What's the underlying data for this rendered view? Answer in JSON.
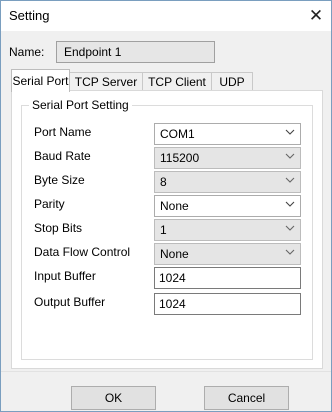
{
  "window": {
    "title": "Setting",
    "close_glyph": "✕"
  },
  "name_field": {
    "label": "Name:",
    "value": "Endpoint 1"
  },
  "tabs": [
    {
      "label": "Serial Port",
      "active": true
    },
    {
      "label": "TCP Server",
      "active": false
    },
    {
      "label": "TCP Client",
      "active": false
    },
    {
      "label": "UDP",
      "active": false
    }
  ],
  "serial": {
    "group_title": "Serial Port Setting",
    "port_name": {
      "label": "Port Name",
      "value": "COM1"
    },
    "baud_rate": {
      "label": "Baud Rate",
      "value": "115200"
    },
    "byte_size": {
      "label": "Byte Size",
      "value": "8"
    },
    "parity": {
      "label": "Parity",
      "value": "None"
    },
    "stop_bits": {
      "label": "Stop Bits",
      "value": "1"
    },
    "flow_control": {
      "label": "Data Flow Control",
      "value": "None"
    },
    "input_buffer": {
      "label": "Input Buffer",
      "value": "1024"
    },
    "output_buffer": {
      "label": "Output Buffer",
      "value": "1024"
    }
  },
  "buttons": {
    "ok": "OK",
    "cancel": "Cancel"
  },
  "icons": {
    "dropdown": "chevron-down-icon",
    "close": "close-icon"
  },
  "colors": {
    "window_border": "#7a9ebf",
    "dialog_bg": "#f0f0f0",
    "disabled_field": "#e5e5e5"
  }
}
